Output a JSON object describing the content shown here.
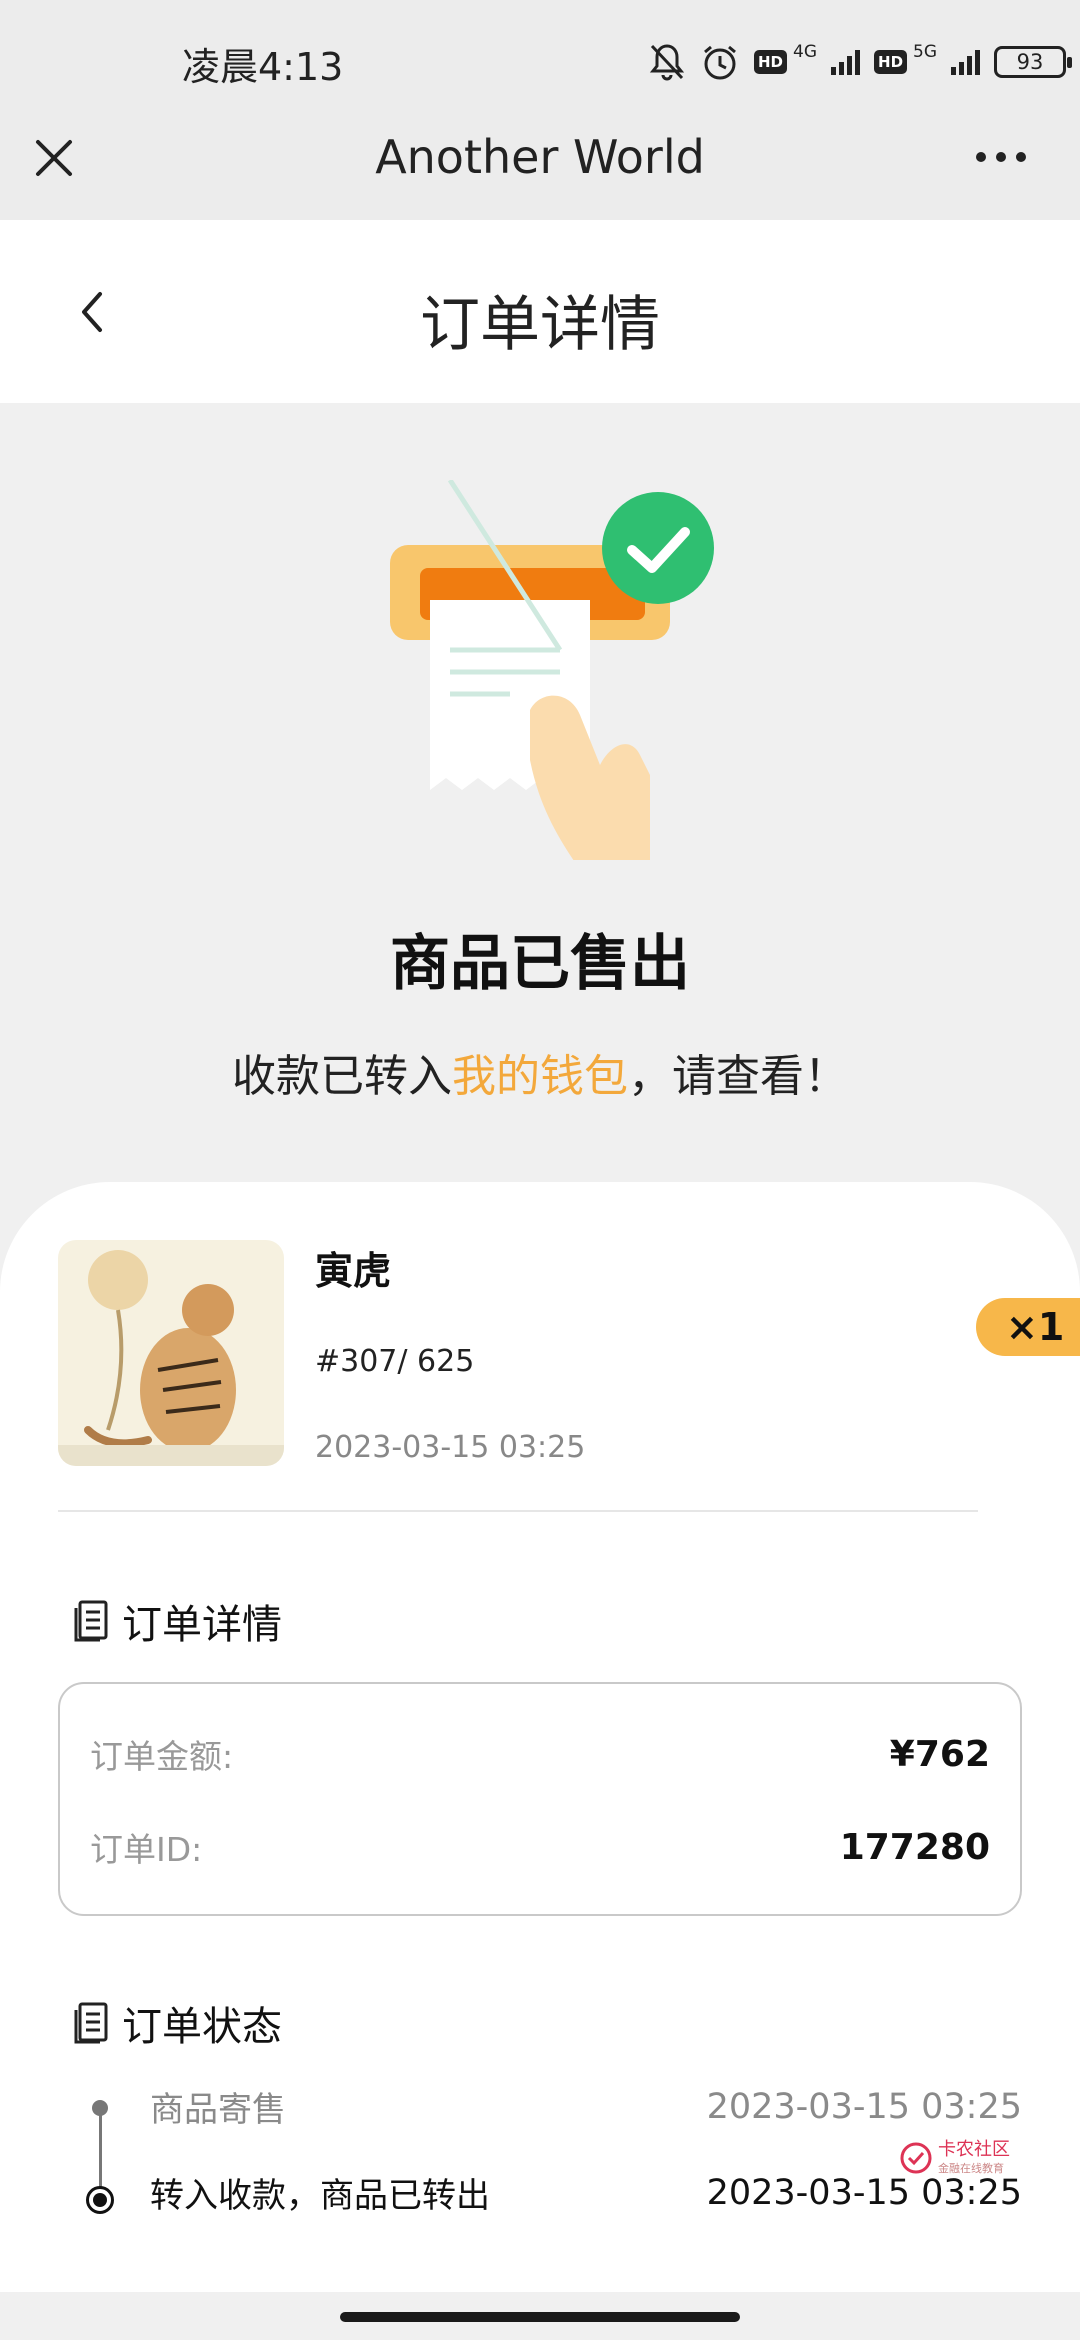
{
  "status_bar": {
    "time": "凌晨4:13",
    "hd1": "HD",
    "net1": "4G",
    "hd2": "HD",
    "net2": "5G",
    "battery": "93"
  },
  "mini_program_bar": {
    "title": "Another World",
    "icons": [
      "close-icon",
      "more-icon"
    ]
  },
  "header": {
    "title": "订单详情",
    "icons": [
      "back-arrow-icon"
    ]
  },
  "hero": {
    "title": "商品已售出",
    "subtitle_prefix": "收款已转入",
    "subtitle_link": "我的钱包",
    "subtitle_suffix": "，请查看！"
  },
  "product": {
    "name": "寅虎",
    "edition": "#307/ 625",
    "time": "2023-03-15 03:25",
    "quantity": "×1"
  },
  "order_details": {
    "title": "订单详情",
    "amount_label": "订单金额:",
    "amount_value": "¥762",
    "id_label": "订单ID:",
    "id_value": "177280"
  },
  "order_status": {
    "title": "订单状态",
    "steps": [
      {
        "label": "商品寄售",
        "time": "2023-03-15 03:25"
      },
      {
        "label": "转入收款，商品已转出",
        "time": "2023-03-15 03:25"
      }
    ]
  },
  "watermark": {
    "text": "卡农社区",
    "subtext": "金融在线教育"
  },
  "colors": {
    "accent": "#f3a83b",
    "badge": "#f7b74a",
    "check_green": "#2fbf71",
    "background": "#f0f0f0"
  }
}
